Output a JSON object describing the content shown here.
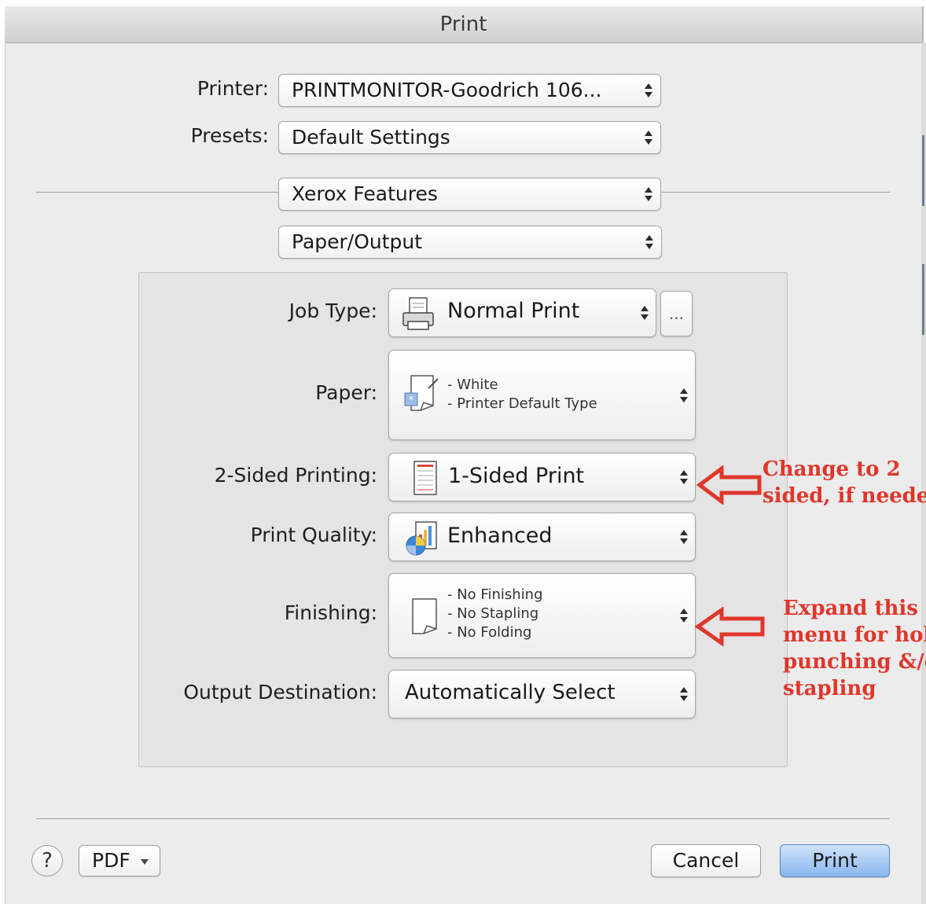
{
  "window": {
    "title": "Print"
  },
  "printer": {
    "label": "Printer:",
    "value": "PRINTMONITOR-Goodrich 106..."
  },
  "presets": {
    "label": "Presets:",
    "value": "Default Settings"
  },
  "panel_selector": {
    "value": "Xerox Features"
  },
  "section_selector": {
    "value": "Paper/Output"
  },
  "job_type": {
    "label": "Job Type:",
    "value": "Normal Print",
    "more_label": "..."
  },
  "paper": {
    "label": "Paper:",
    "lines": [
      "- White",
      "- Printer Default Type"
    ]
  },
  "two_sided": {
    "label": "2-Sided Printing:",
    "value": "1-Sided Print"
  },
  "print_quality": {
    "label": "Print Quality:",
    "value": "Enhanced"
  },
  "finishing": {
    "label": "Finishing:",
    "lines": [
      "- No Finishing",
      "- No Stapling",
      "- No Folding"
    ]
  },
  "output_destination": {
    "label": "Output Destination:",
    "value": "Automatically Select"
  },
  "annotations": [
    {
      "lines": [
        "Change to 2",
        "sided, if needed"
      ]
    },
    {
      "lines": [
        "Expand this",
        "menu for hole",
        "punching &/or",
        "stapling"
      ]
    }
  ],
  "footer": {
    "help": "?",
    "pdf": "PDF",
    "cancel": "Cancel",
    "print": "Print"
  },
  "colors": {
    "annotation": "#e0362b",
    "print_button": "#8ab6ef"
  }
}
